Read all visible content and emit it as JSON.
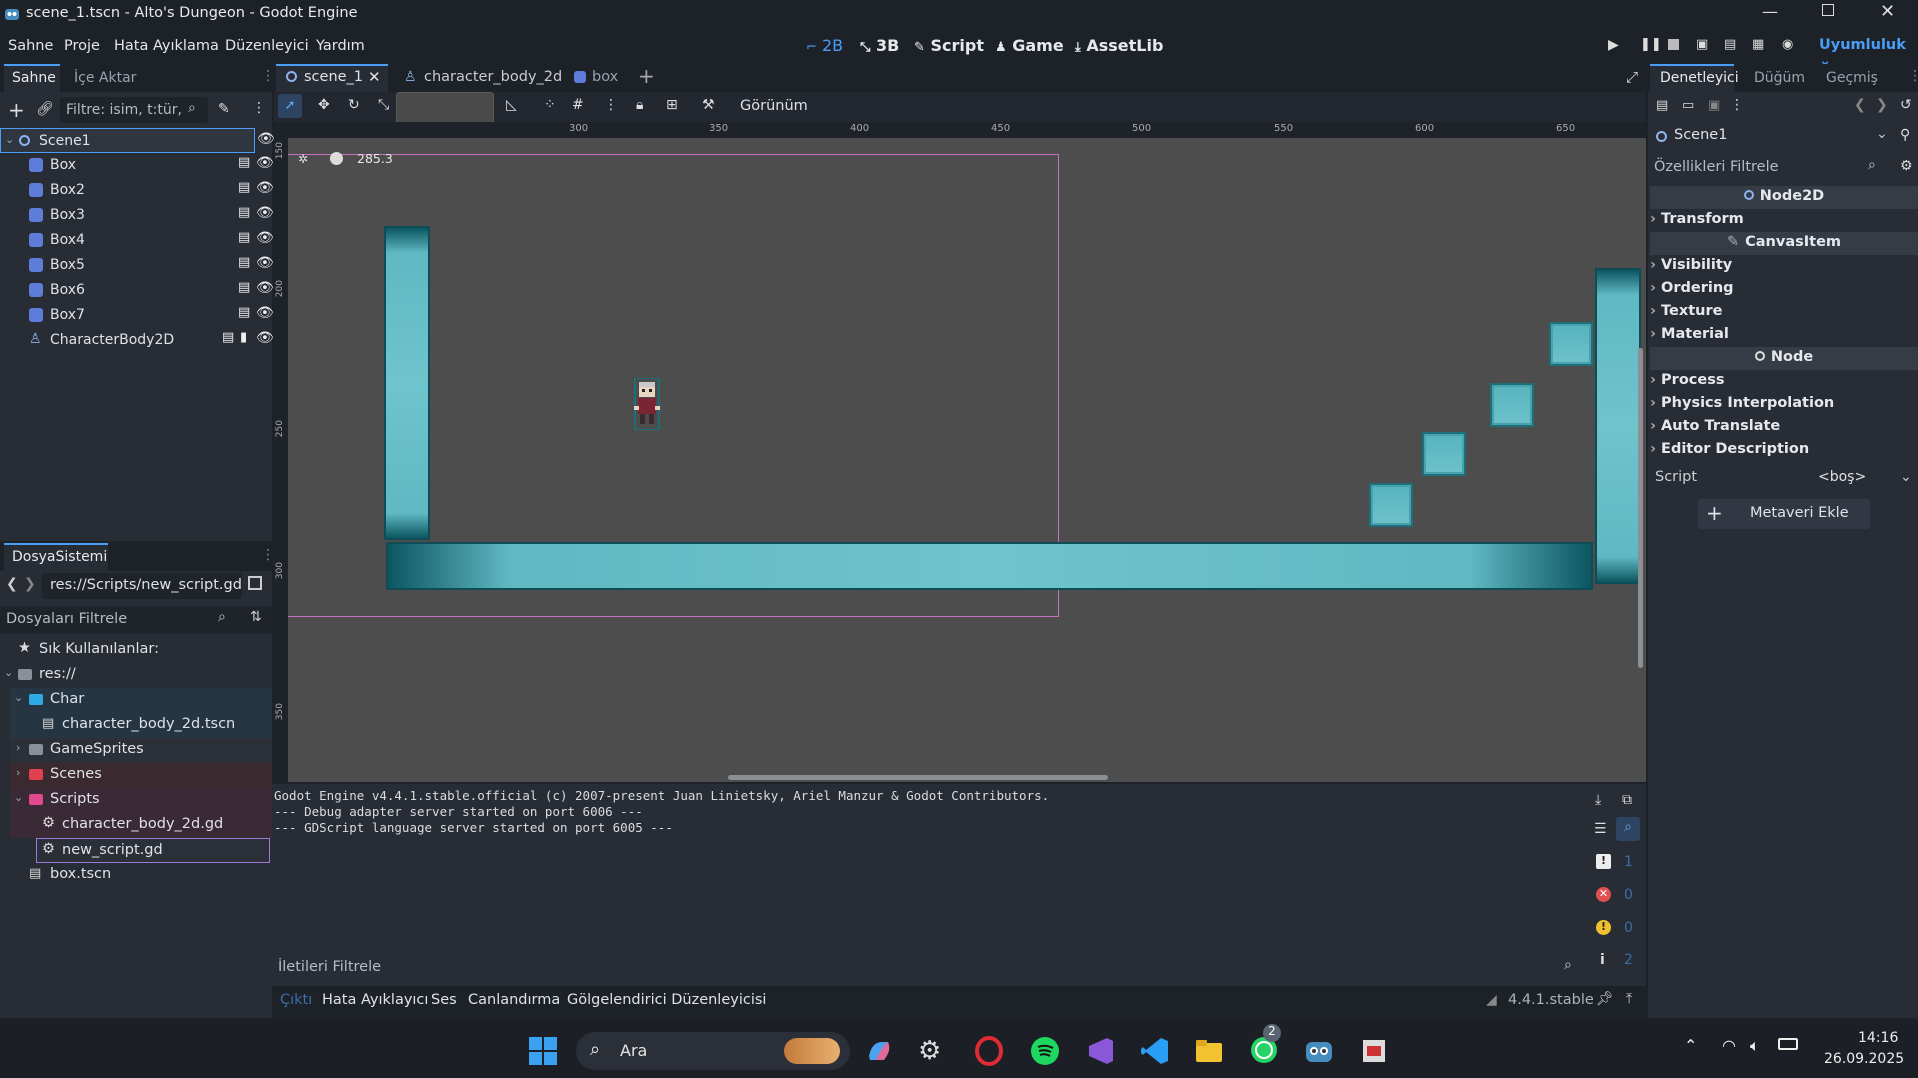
{
  "window": {
    "title": "scene_1.tscn - Alto's Dungeon - Godot Engine"
  },
  "menu": [
    "Sahne",
    "Proje",
    "Hata Ayıklama",
    "Düzenleyici",
    "Yardım"
  ],
  "modes": {
    "m2d": "2B",
    "m3d": "3B",
    "script": "Script",
    "game": "Game",
    "assetlib": "AssetLib"
  },
  "renderer": "Uyumluluk",
  "scene_panel": {
    "tabs": [
      "Sahne",
      "İçe Aktar"
    ],
    "filter_placeholder": "Filtre: isim, t:tür, g:grup",
    "nodes": [
      {
        "label": "Scene1",
        "type": "node2d"
      },
      {
        "label": "Box",
        "type": "box"
      },
      {
        "label": "Box2",
        "type": "box"
      },
      {
        "label": "Box3",
        "type": "box"
      },
      {
        "label": "Box4",
        "type": "box"
      },
      {
        "label": "Box5",
        "type": "box"
      },
      {
        "label": "Box6",
        "type": "box"
      },
      {
        "label": "Box7",
        "type": "box"
      },
      {
        "label": "CharacterBody2D",
        "type": "character"
      }
    ]
  },
  "filesystem": {
    "title": "DosyaSistemi",
    "path": "res://Scripts/new_script.gd",
    "filter_placeholder": "Dosyaları Filtrele",
    "items": [
      {
        "label": "Sık Kullanılanlar:",
        "icon": "star-icon"
      },
      {
        "label": "res://",
        "icon": "folder-icon"
      },
      {
        "label": "Char",
        "icon": "folder-icon",
        "color": "#2ea9e6"
      },
      {
        "label": "character_body_2d.tscn",
        "icon": "scene-file-icon"
      },
      {
        "label": "GameSprites",
        "icon": "folder-icon",
        "color": "#8a8f99"
      },
      {
        "label": "Scenes",
        "icon": "folder-icon",
        "color": "#e0414f"
      },
      {
        "label": "Scripts",
        "icon": "folder-icon",
        "color": "#e24a8d"
      },
      {
        "label": "character_body_2d.gd",
        "icon": "gear-icon"
      },
      {
        "label": "new_script.gd",
        "icon": "gear-icon"
      },
      {
        "label": "box.tscn",
        "icon": "scene-file-icon"
      }
    ]
  },
  "editor_tabs": [
    "scene_1",
    "character_body_2d",
    "box"
  ],
  "toolbar": {
    "view_label": "Görünüm",
    "zoom": "285.3"
  },
  "ruler_ticks": [
    "300",
    "350",
    "400",
    "450",
    "500",
    "550",
    "600",
    "650"
  ],
  "ruler_vticks": [
    "150",
    "200",
    "250",
    "300",
    "350"
  ],
  "console": {
    "lines": [
      "Godot Engine v4.4.1.stable.official (c) 2007-present Juan Linietsky, Ariel Manzur & Godot Contributors.",
      "--- Debug adapter server started on port 6006 ---",
      "--- GDScript language server started on port 6005 ---"
    ],
    "filter_placeholder": "İletileri Filtrele",
    "counts": {
      "messages": "1",
      "errors": "0",
      "warnings": "0",
      "info": "2"
    }
  },
  "bottom_tabs": [
    "Çıktı",
    "Hata Ayıklayıcı",
    "Ses",
    "Canlandırma",
    "Gölgelendirici Düzenleyicisi"
  ],
  "version": "4.4.1.stable",
  "inspector": {
    "tabs": [
      "Denetleyici",
      "Düğüm",
      "Geçmiş"
    ],
    "node_name": "Scene1",
    "filter_placeholder": "Özellikleri Filtrele",
    "sections": [
      {
        "header": "Node2D",
        "items": [
          "Transform"
        ]
      },
      {
        "header": "CanvasItem",
        "items": [
          "Visibility",
          "Ordering",
          "Texture",
          "Material"
        ]
      },
      {
        "header": "Node",
        "items": [
          "Process",
          "Physics Interpolation",
          "Auto Translate",
          "Editor Description"
        ]
      }
    ],
    "script_label": "Script",
    "script_value": "<boş>",
    "add_metadata": "Metaveri Ekle"
  },
  "taskbar": {
    "search": "Ara",
    "time": "14:16",
    "date": "26.09.2025",
    "whatsapp_badge": "2"
  },
  "colors": {
    "accent": "#4a9ef8",
    "tile": "#6ec2ca",
    "viewport_bg": "#4d4d4d"
  }
}
